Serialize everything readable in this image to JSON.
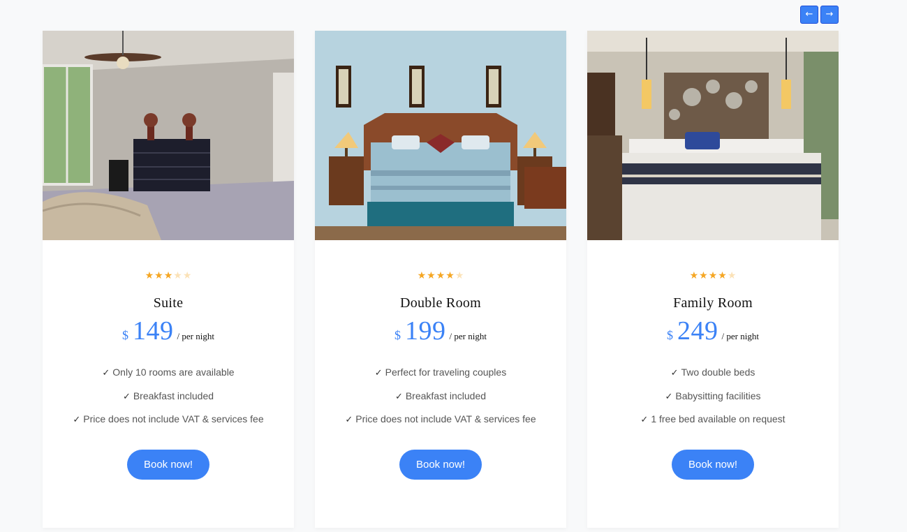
{
  "carousel": {
    "prev_icon": "arrow-left-icon",
    "next_icon": "arrow-right-icon",
    "prev_glyph": "←",
    "next_glyph": "→"
  },
  "colors": {
    "accent": "#3b82f6",
    "star": "#f5a623",
    "text": "#555555"
  },
  "rooms": [
    {
      "name": "Suite",
      "rating": 3,
      "max_rating": 5,
      "currency": "$",
      "price": "149",
      "per": "/ per night",
      "features": [
        "Only 10 rooms are available",
        "Breakfast included",
        "Price does not include VAT & services fee"
      ],
      "button": "Book now!"
    },
    {
      "name": "Double Room",
      "rating": 4,
      "max_rating": 5,
      "currency": "$",
      "price": "199",
      "per": "/ per night",
      "features": [
        "Perfect for traveling couples",
        "Breakfast included",
        "Price does not include VAT & services fee"
      ],
      "button": "Book now!"
    },
    {
      "name": "Family Room",
      "rating": 4,
      "max_rating": 5,
      "currency": "$",
      "price": "249",
      "per": "/ per night",
      "features": [
        "Two double beds",
        "Babysitting facilities",
        "1 free bed available on request"
      ],
      "button": "Book now!"
    }
  ]
}
